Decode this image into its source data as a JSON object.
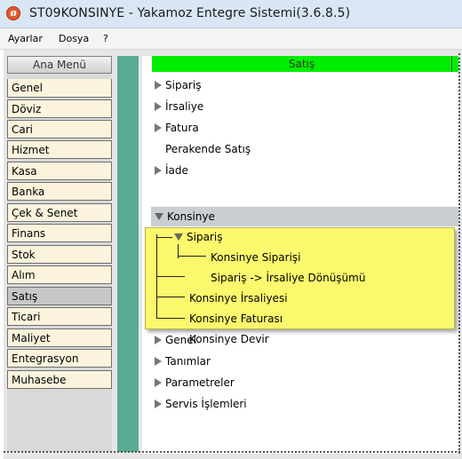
{
  "window": {
    "title": "ST09KONSINYE - Yakamoz Entegre Sistemi(3.6.8.5)",
    "icon": "app-logo-icon"
  },
  "menubar": {
    "items": [
      "Ayarlar",
      "Dosya",
      "?"
    ]
  },
  "sidebar": {
    "header": "Ana Menü",
    "items": [
      "Genel",
      "Döviz",
      "Cari",
      "Hizmet",
      "Kasa",
      "Banka",
      "Çek & Senet",
      "Finans",
      "Stok",
      "Alım",
      "Satış",
      "Ticari",
      "Maliyet",
      "Entegrasyon",
      "Muhasebe"
    ],
    "selected": "Satış"
  },
  "content": {
    "header": "Satış",
    "header_color": "#00ee00",
    "tree": [
      "Sipariş",
      "İrsaliye",
      "Fatura",
      "Perakende Satış",
      "İade",
      "Konsinye"
    ],
    "selected": "Konsinye",
    "submenu": {
      "items": [
        "Sipariş",
        "Konsinye Siparişi",
        "Sipariş -> İrsaliye Dönüşümü",
        "Konsinye İrsaliyesi",
        "Konsinye Faturası",
        "Konsinye Devir"
      ],
      "background": "#fbf86d"
    },
    "tree_after": [
      "Genel",
      "Tanımlar",
      "Parametreler",
      "Servis İşlemleri"
    ]
  }
}
